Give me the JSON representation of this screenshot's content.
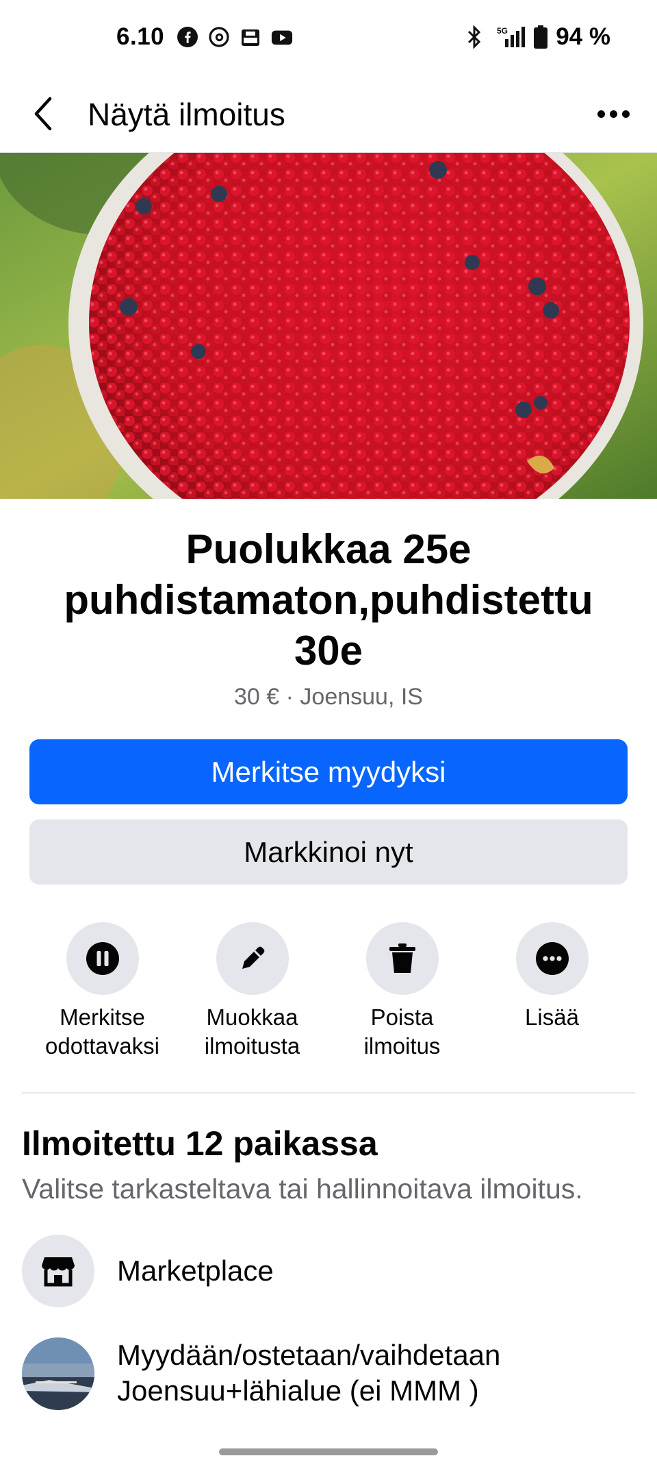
{
  "status_bar": {
    "time": "6.10",
    "app_icons": [
      "facebook-icon",
      "threads-icon",
      "pdf-icon",
      "youtube-icon"
    ],
    "network": "5G",
    "battery": "94 %"
  },
  "nav": {
    "title": "Näytä ilmoitus",
    "back_icon": "chevron-left-icon",
    "more_icon": "more-horizontal-icon"
  },
  "listing": {
    "photo": "lingonberries-in-bowl",
    "title": "Puolukkaa 25e puhdistamaton,puhdistettu 30e",
    "price_location": "30 € · Joensuu, IS"
  },
  "buttons": {
    "mark_sold": "Merkitse myydyksi",
    "promote": "Markkinoi nyt"
  },
  "actions": [
    {
      "icon": "pause-icon",
      "label_line1": "Merkitse",
      "label_line2": "odottavaksi"
    },
    {
      "icon": "pencil-icon",
      "label_line1": "Muokkaa",
      "label_line2": "ilmoitusta"
    },
    {
      "icon": "trash-icon",
      "label_line1": "Poista",
      "label_line2": "ilmoitus"
    },
    {
      "icon": "more-circle-icon",
      "label_line1": "Lisää",
      "label_line2": ""
    }
  ],
  "listed_in": {
    "title": "Ilmoitettu 12 paikassa",
    "subtitle": "Valitse tarkasteltava tai hallinnoitava ilmoitus.",
    "places": [
      {
        "icon": "storefront-icon",
        "name": "Marketplace"
      },
      {
        "icon": "group-avatar",
        "name_line1": "Myydään/ostetaan/vaihdetaan",
        "name_line2": "Joensuu+lähialue (ei MMM )"
      }
    ]
  },
  "colors": {
    "primary": "#0866ff",
    "secondary_bg": "#e4e6eb",
    "muted_text": "#65676b"
  }
}
